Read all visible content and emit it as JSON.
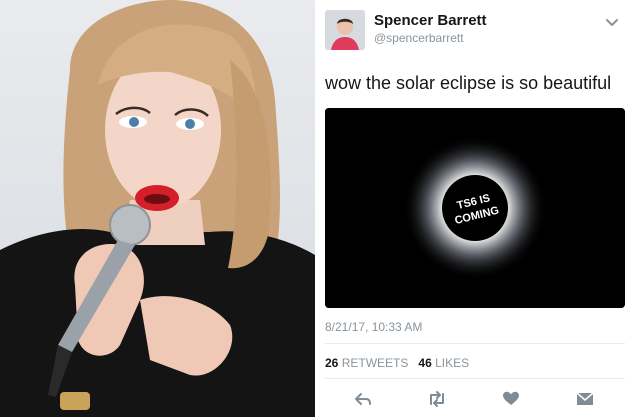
{
  "tweet": {
    "display_name": "Spencer Barrett",
    "handle": "@spencerbarrett",
    "text": "wow the solar eclipse is so beautiful",
    "image_text_line1": "TS6 IS",
    "image_text_line2": "COMING",
    "timestamp": "8/21/17, 10:33 AM",
    "retweets_count": "26",
    "retweets_label": "RETWEETS",
    "likes_count": "46",
    "likes_label": "LIKES"
  },
  "icons": {
    "caret": "chevron-down-icon",
    "reply": "reply-icon",
    "retweet": "retweet-icon",
    "like": "heart-icon",
    "message": "envelope-icon"
  },
  "colors": {
    "text": "#14171a",
    "muted": "#8a949c",
    "action_icon": "#7f8b95"
  }
}
